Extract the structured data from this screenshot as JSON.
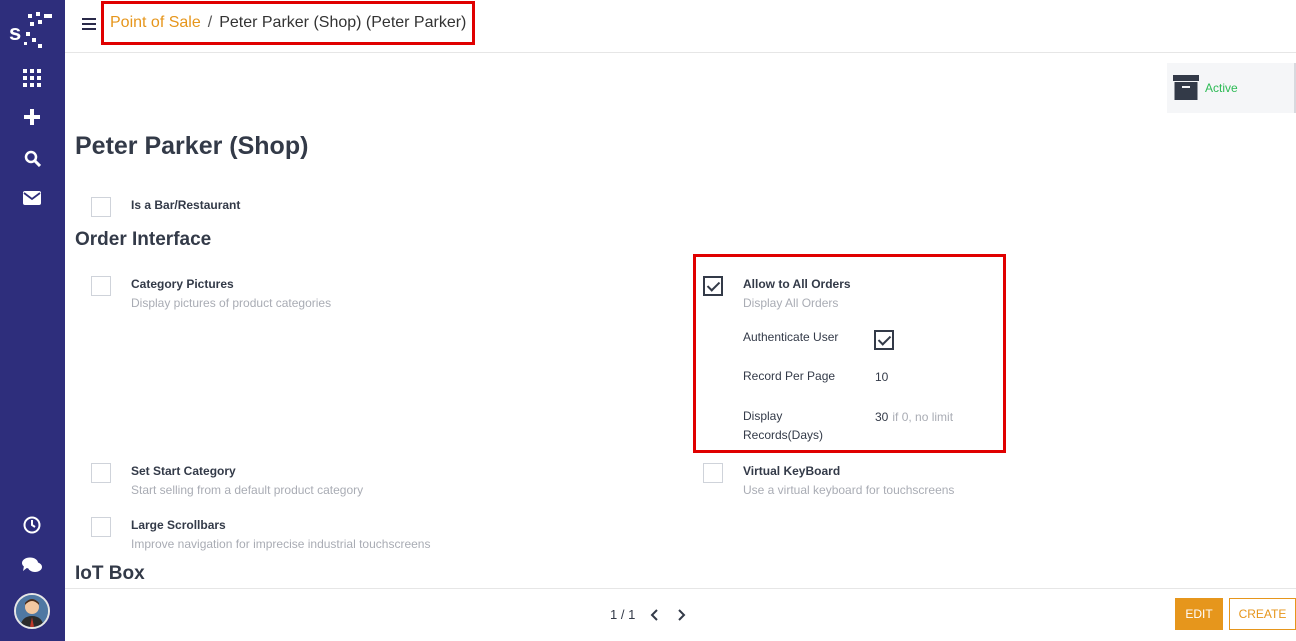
{
  "breadcrumb": {
    "parent": "Point of Sale",
    "separator": "/",
    "current": "Peter Parker (Shop) (Peter Parker)"
  },
  "status": {
    "label": "Active",
    "icon": "archive-icon"
  },
  "record": {
    "title": "Peter Parker (Shop)",
    "is_bar_restaurant": {
      "label": "Is a Bar/Restaurant",
      "checked": false
    }
  },
  "order_interface": {
    "heading": "Order Interface",
    "category_pictures": {
      "label": "Category Pictures",
      "desc": "Display pictures of product categories",
      "checked": false
    },
    "allow_all_orders": {
      "label": "Allow to All Orders",
      "desc": "Display All Orders",
      "checked": true
    },
    "authenticate_user": {
      "label": "Authenticate User",
      "checked": true
    },
    "record_per_page": {
      "label": "Record Per Page",
      "value": "10"
    },
    "display_records_days": {
      "label": "Display Records(Days)",
      "value": "30",
      "hint": "if 0, no limit"
    },
    "set_start_category": {
      "label": "Set Start Category",
      "desc": "Start selling from a default product category",
      "checked": false
    },
    "virtual_keyboard": {
      "label": "Virtual KeyBoard",
      "desc": "Use a virtual keyboard for touchscreens",
      "checked": false
    },
    "large_scrollbars": {
      "label": "Large Scrollbars",
      "desc": "Improve navigation for imprecise industrial touchscreens",
      "checked": false
    }
  },
  "iot_box": {
    "heading": "IoT Box"
  },
  "pager": {
    "text": "1 / 1"
  },
  "footer": {
    "edit_label": "EDIT",
    "create_label": "CREATE"
  },
  "colors": {
    "sidebar": "#2e2e7c",
    "accent": "#e6961c",
    "active": "#2dbb55",
    "highlight": "#e00000"
  }
}
